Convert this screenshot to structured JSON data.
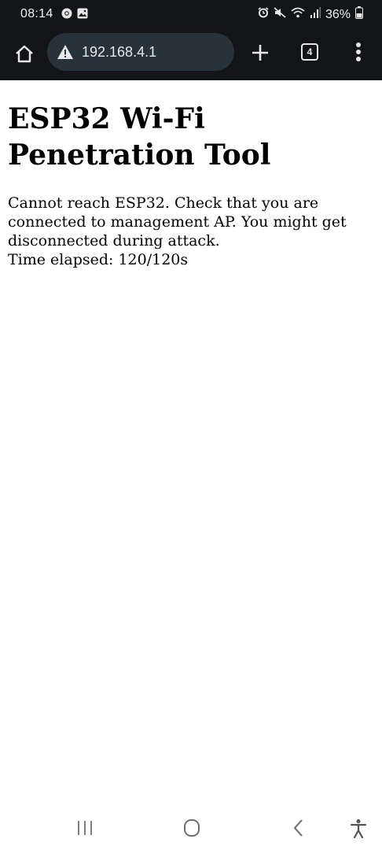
{
  "status_bar": {
    "time": "08:14",
    "battery": "36%",
    "left_icons": [
      "chrome-icon",
      "gallery-icon"
    ],
    "right_icons": [
      "alarm-icon",
      "mute-icon",
      "wifi-icon",
      "signal-icon",
      "battery-icon"
    ]
  },
  "browser": {
    "url": "192.168.4.1",
    "tab_count": "4",
    "icons": [
      "home-icon",
      "warning-icon",
      "plus-icon",
      "more-vert-icon"
    ]
  },
  "page": {
    "heading": "ESP32 Wi-Fi Penetration Tool",
    "message_line1": "Cannot reach ESP32. Check that you are connected to management AP. You might get disconnected during attack.",
    "message_line2": "Time elapsed: 120/120s"
  },
  "nav_bar": {
    "icons": [
      "recents-icon",
      "home-circle-icon",
      "back-icon",
      "accessibility-icon"
    ]
  },
  "colors": {
    "browser_chrome": "#121417",
    "url_bar": "#27323b"
  }
}
